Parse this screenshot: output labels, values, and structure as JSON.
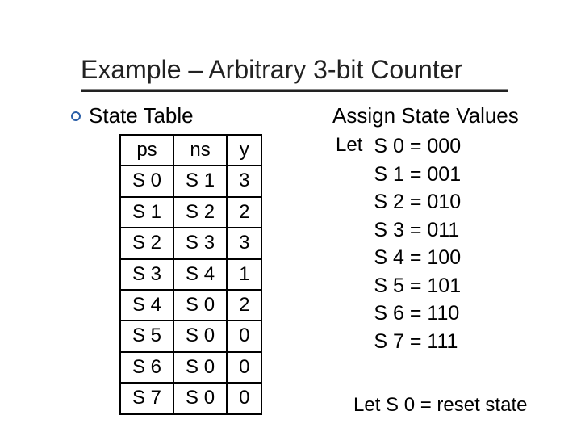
{
  "title": "Example – Arbitrary 3-bit Counter",
  "section_label": "State Table",
  "table": {
    "headers": [
      "ps",
      "ns",
      "y"
    ],
    "rows": [
      [
        "S 0",
        "S 1",
        "3"
      ],
      [
        "S 1",
        "S 2",
        "2"
      ],
      [
        "S 2",
        "S 3",
        "3"
      ],
      [
        "S 3",
        "S 4",
        "1"
      ],
      [
        "S 4",
        "S 0",
        "2"
      ],
      [
        "S 5",
        "S 0",
        "0"
      ],
      [
        "S 6",
        "S 0",
        "0"
      ],
      [
        "S 7",
        "S 0",
        "0"
      ]
    ]
  },
  "assign_title": "Assign State Values",
  "let_label": "Let",
  "assignments": [
    "S 0 = 000",
    "S 1 = 001",
    "S 2 = 010",
    "S 3 = 011",
    "S 4 = 100",
    "S 5 = 101",
    "S 6 = 110",
    "S 7 = 111"
  ],
  "reset_note": "Let S 0 = reset state"
}
